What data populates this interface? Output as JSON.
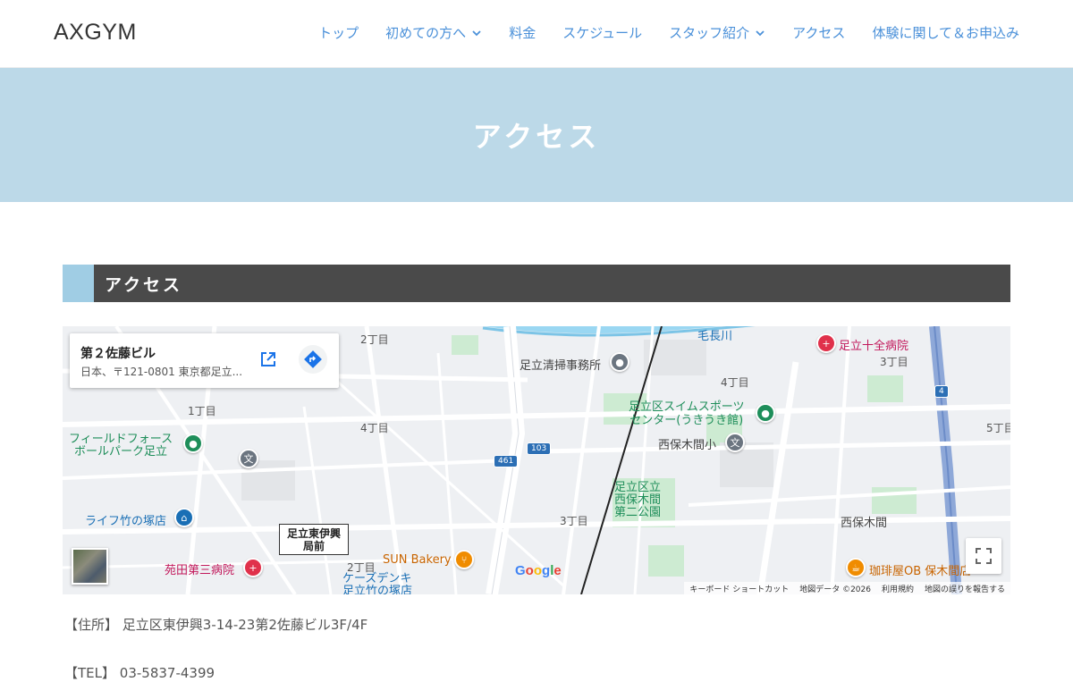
{
  "header": {
    "logo": "AXGYM",
    "nav": [
      {
        "label": "トップ",
        "has_dropdown": false
      },
      {
        "label": "初めての方へ",
        "has_dropdown": true
      },
      {
        "label": "料金",
        "has_dropdown": false
      },
      {
        "label": "スケジュール",
        "has_dropdown": false
      },
      {
        "label": "スタッフ紹介",
        "has_dropdown": true
      },
      {
        "label": "アクセス",
        "has_dropdown": false
      },
      {
        "label": "体験に関して＆お申込み",
        "has_dropdown": false
      }
    ]
  },
  "banner": {
    "title": "アクセス"
  },
  "section": {
    "title": "アクセス"
  },
  "map": {
    "info": {
      "name": "第２佐藤ビル",
      "address": "日本、〒121-0801 東京都足立..."
    },
    "busstop": "足立東伊興\n局前",
    "labels": {
      "chome2": "2丁目",
      "chome1": "1丁目",
      "chome4a": "4丁目",
      "chome4b": "4丁目",
      "chome3a": "3丁目",
      "chome3b": "3丁目",
      "chome2b": "2丁目",
      "chome5": "5丁目",
      "river": "毛長川",
      "seisou": "足立清掃事務所",
      "hospital1": "足立十全病院",
      "swim": "足立区スイムスポーツ\nセンター(うきうき館)",
      "school": "西保木間小",
      "field": "フィールドフォース\nボールパーク足立",
      "park": "足立区立\n西保木間\n第二公園",
      "life": "ライフ竹の塚店",
      "hospital2": "苑田第三病院",
      "bakery": "SUN Bakery",
      "kaden": "ケーズデンキ\n足立竹の塚店",
      "nishi": "西保木間",
      "cafe": "珈琲屋OB 保木間店",
      "route461": "461",
      "route103": "103",
      "route4": "4"
    },
    "google": "Google",
    "attribution": [
      "キーボード ショートカット",
      "地図データ ©2026",
      "利用規約",
      "地図の誤りを報告する"
    ]
  },
  "address": {
    "label": "【住所】",
    "value": "足立区東伊興3-14-23第2佐藤ビル3F/4F"
  },
  "tel": {
    "label": "【TEL】",
    "value": "03-5837-4399"
  }
}
